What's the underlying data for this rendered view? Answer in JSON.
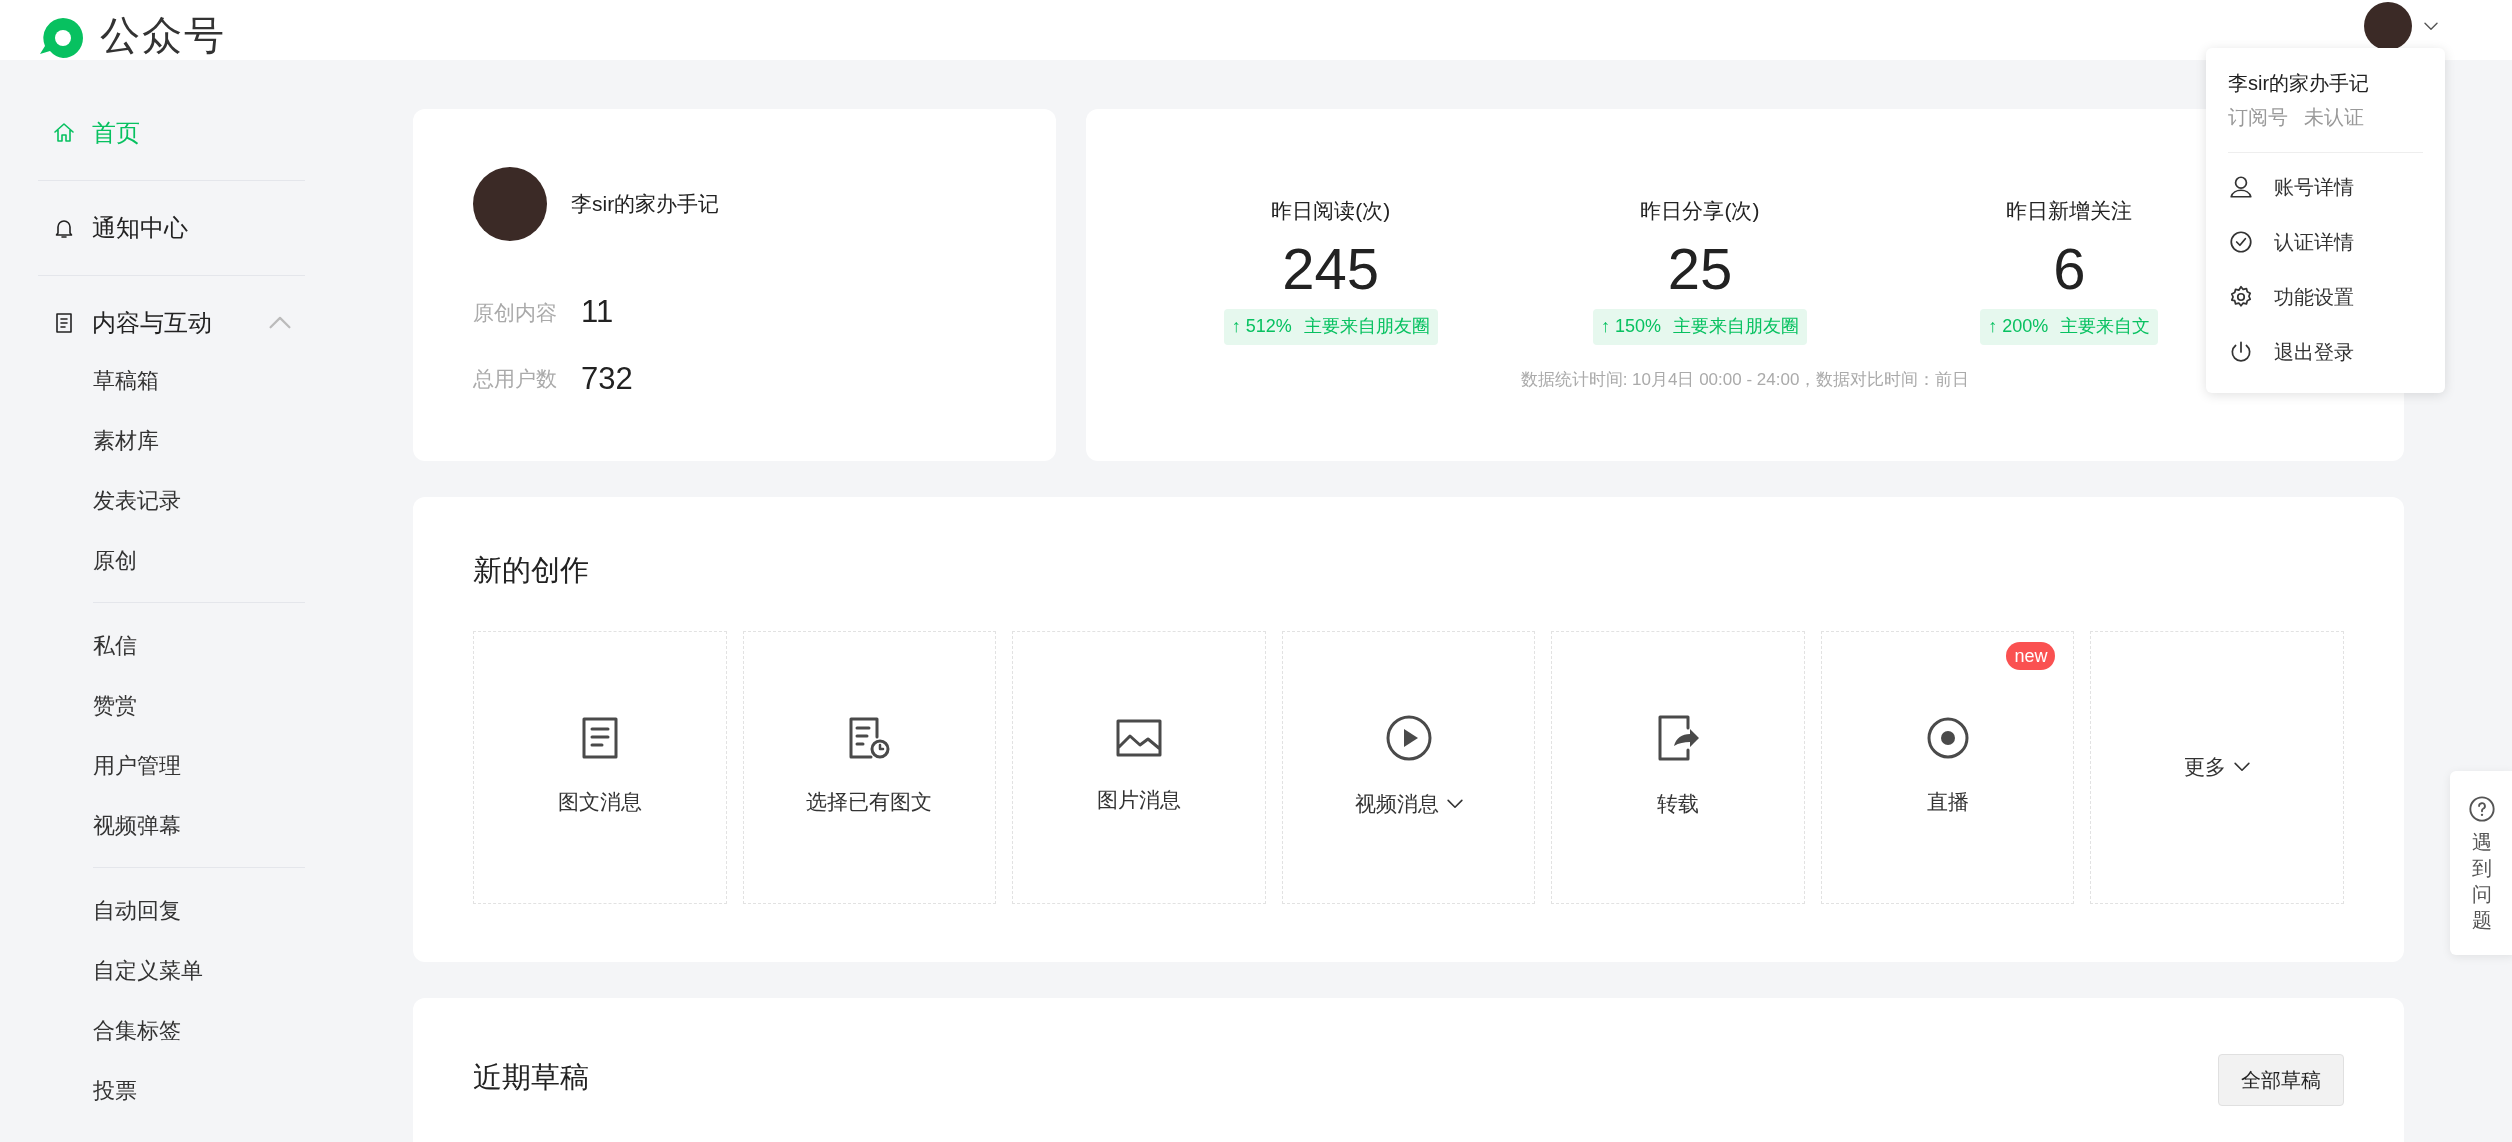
{
  "header": {
    "logo_text": "公众号"
  },
  "sidebar": {
    "items": [
      {
        "label": "首页",
        "kind": "home",
        "selected": true
      },
      {
        "label": "通知中心",
        "kind": "bell",
        "selected": false
      },
      {
        "label": "内容与互动",
        "kind": "doc",
        "selected": false,
        "expanded": true,
        "groups": [
          [
            {
              "label": "草稿箱",
              "selected": false
            },
            {
              "label": "素材库",
              "selected": false
            },
            {
              "label": "发表记录",
              "selected": false
            },
            {
              "label": "原创",
              "selected": false
            }
          ],
          [
            {
              "label": "私信",
              "selected": false
            },
            {
              "label": "赞赏",
              "selected": false
            },
            {
              "label": "用户管理",
              "selected": false
            },
            {
              "label": "视频弹幕",
              "selected": false
            }
          ],
          [
            {
              "label": "自动回复",
              "selected": false
            },
            {
              "label": "自定义菜单",
              "selected": false
            },
            {
              "label": "合集标签",
              "selected": false
            },
            {
              "label": "投票",
              "selected": false
            }
          ]
        ]
      }
    ]
  },
  "account_card": {
    "name": "李sir的家办手记",
    "stats": [
      {
        "label": "原创内容",
        "value": "11"
      },
      {
        "label": "总用户数",
        "value": "732"
      }
    ]
  },
  "stats_card": {
    "metrics": [
      {
        "label": "昨日阅读(次)",
        "value": "245",
        "change": "↑ 512%",
        "source": "主要来自朋友圈"
      },
      {
        "label": "昨日分享(次)",
        "value": "25",
        "change": "↑ 150%",
        "source": "主要来自朋友圈"
      },
      {
        "label": "昨日新增关注",
        "value": "6",
        "change": "↑ 200%",
        "source": "主要来自文"
      }
    ],
    "note": "数据统计时间: 10月4日 00:00 - 24:00，数据对比时间：前日"
  },
  "creation": {
    "title": "新的创作",
    "tiles": [
      {
        "label": "图文消息",
        "kind": "article",
        "dropdown": false
      },
      {
        "label": "选择已有图文",
        "kind": "article-clock",
        "dropdown": false
      },
      {
        "label": "图片消息",
        "kind": "image",
        "dropdown": false
      },
      {
        "label": "视频消息",
        "kind": "play",
        "dropdown": true
      },
      {
        "label": "转载",
        "kind": "share",
        "dropdown": false
      },
      {
        "label": "直播",
        "kind": "live",
        "dropdown": false,
        "badge": "new"
      },
      {
        "label": "更多",
        "kind": "more",
        "dropdown": true
      }
    ]
  },
  "drafts": {
    "title": "近期草稿",
    "button": "全部草稿"
  },
  "account_menu": {
    "name": "李sir的家办手记",
    "type": "订阅号",
    "verification": "未认证",
    "items": [
      {
        "label": "账号详情",
        "kind": "user"
      },
      {
        "label": "认证详情",
        "kind": "check"
      },
      {
        "label": "功能设置",
        "kind": "gear"
      },
      {
        "label": "退出登录",
        "kind": "power"
      }
    ]
  },
  "help_tab": {
    "label": "遇到问题"
  }
}
